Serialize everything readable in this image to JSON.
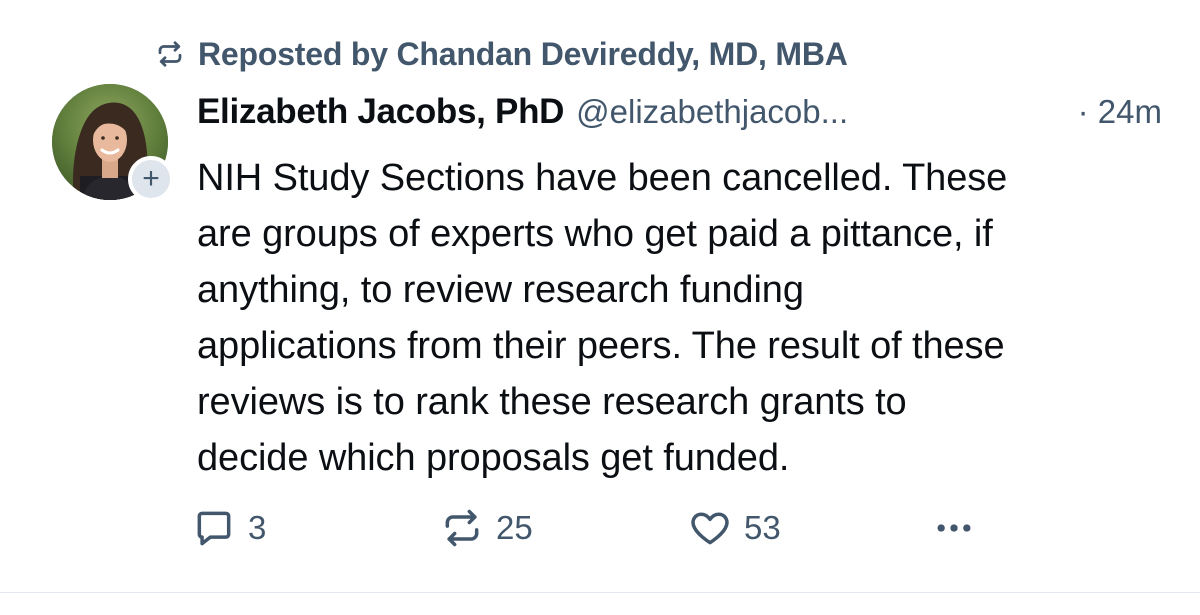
{
  "repost": {
    "label": "Reposted by Chandan Devireddy, MD, MBA",
    "icon": "repost-icon"
  },
  "author": {
    "name": "Elizabeth Jacobs, PhD",
    "handle": "@elizabethjacob...",
    "timestamp": "· 24m",
    "follow_label": "+"
  },
  "post": {
    "lines": [
      "NIH Study Sections have been cancelled. These",
      "are groups of experts who get paid a pittance, if",
      "anything, to review research funding",
      "applications from their peers. The result of these",
      "reviews is to rank these research grants to",
      "decide which proposals get funded."
    ]
  },
  "actions": {
    "reply_count": "3",
    "repost_count": "25",
    "like_count": "53"
  },
  "colors": {
    "muted": "#42576c",
    "text": "#0b0f14",
    "follow_bg": "#dfe5ec"
  }
}
